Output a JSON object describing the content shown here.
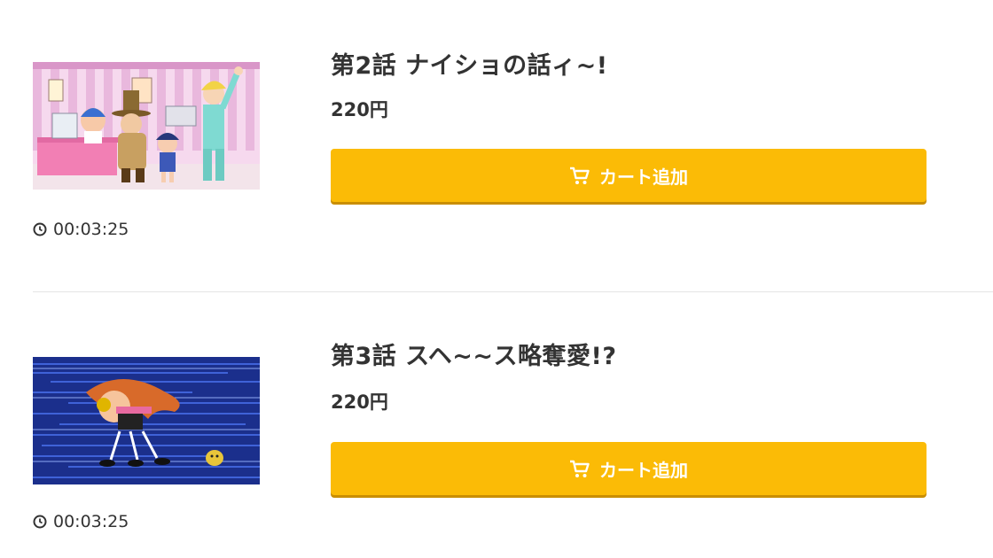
{
  "episodes": [
    {
      "title": "第2話 ナイショの話ィ~!",
      "price": "220円",
      "duration": "00:03:25",
      "cart_label": "カート追加"
    },
    {
      "title": "第3話 スヘ~~ス略奪愛!?",
      "price": "220円",
      "duration": "00:03:25",
      "cart_label": "カート追加"
    }
  ],
  "colors": {
    "accent": "#fbbb06",
    "text": "#333333",
    "divider": "#e4e4e4"
  },
  "icons": [
    "clock-icon",
    "cart-icon"
  ]
}
